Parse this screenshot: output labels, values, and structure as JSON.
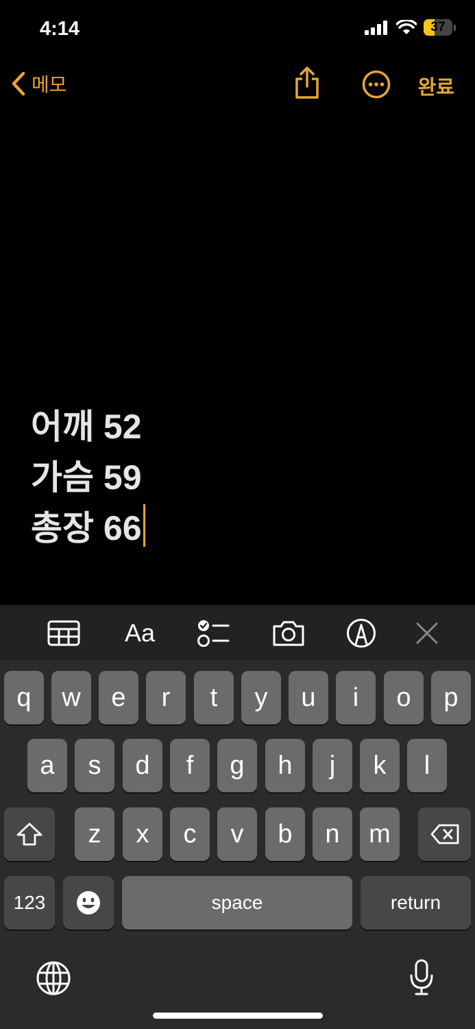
{
  "status": {
    "time": "4:14",
    "battery": "37"
  },
  "nav": {
    "back_label": "메모",
    "done_label": "완료"
  },
  "note": {
    "lines": [
      "어깨 52",
      "가슴 59",
      "총장 66"
    ]
  },
  "toolbar": {
    "format_label": "Aa"
  },
  "keyboard": {
    "row1": [
      "q",
      "w",
      "e",
      "r",
      "t",
      "y",
      "u",
      "i",
      "o",
      "p"
    ],
    "row2": [
      "a",
      "s",
      "d",
      "f",
      "g",
      "h",
      "j",
      "k",
      "l"
    ],
    "row3": [
      "z",
      "x",
      "c",
      "v",
      "b",
      "n",
      "m"
    ],
    "numbers_label": "123",
    "space_label": "space",
    "return_label": "return"
  },
  "colors": {
    "accent": "#e8a72e",
    "background": "#000000",
    "key": "#6b6b6b",
    "key_func": "#474747",
    "keyboard_bg": "#2b2b2b"
  }
}
